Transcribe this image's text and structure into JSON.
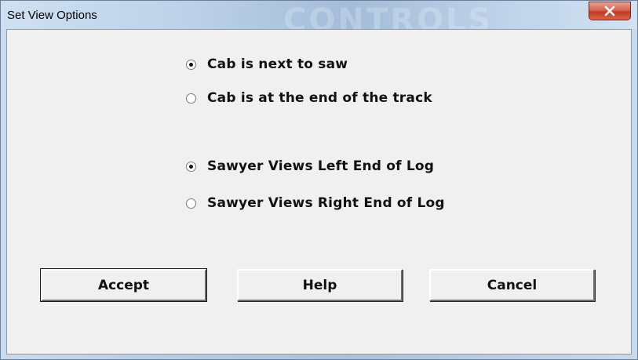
{
  "window": {
    "title": "Set View Options",
    "watermark_text": "CONTROLS",
    "close_icon": "close-icon"
  },
  "cab_position": {
    "options": [
      {
        "label": "Cab is next to saw",
        "checked": true
      },
      {
        "label": "Cab is at the end of the track",
        "checked": false
      }
    ]
  },
  "sawyer_view": {
    "options": [
      {
        "label": "Sawyer Views Left End of Log",
        "checked": true
      },
      {
        "label": "Sawyer Views Right End of Log",
        "checked": false
      }
    ]
  },
  "buttons": {
    "accept": "Accept",
    "help": "Help",
    "cancel": "Cancel"
  },
  "colors": {
    "dialog_bg": "#f0f0f0",
    "titlebar": "#bcd1e8",
    "close_red": "#c23a22"
  }
}
